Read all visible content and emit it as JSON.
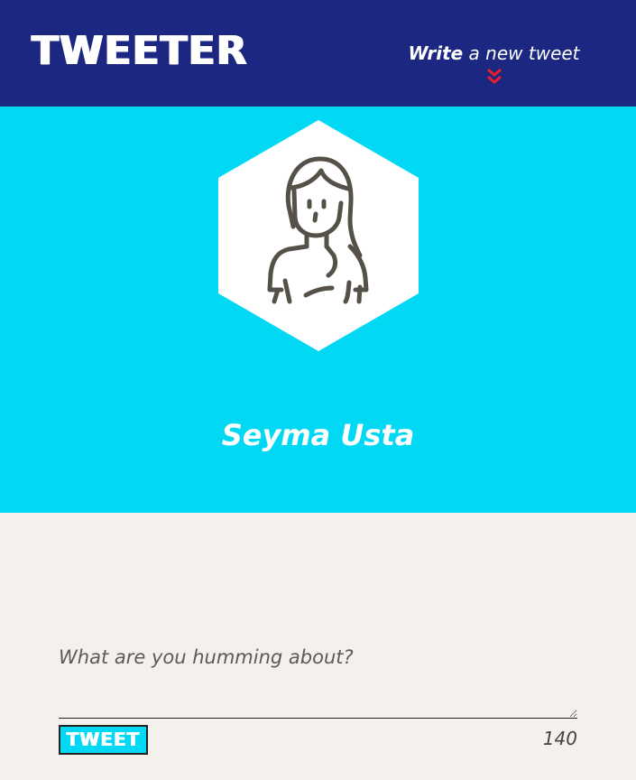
{
  "nav": {
    "logo": "TWEETER",
    "write_strong": "Write",
    "write_rest": " a new tweet",
    "toggle_icon": "double-chevron-down-icon"
  },
  "profile": {
    "name": "Seyma Usta",
    "avatar_icon": "woman-avatar-icon"
  },
  "compose": {
    "placeholder": "What are you humming about?",
    "value": "",
    "button_label": "TWEET",
    "char_count": "140"
  },
  "colors": {
    "nav_bg": "#1c2781",
    "profile_bg": "#00d8f4",
    "page_bg": "#f4f1ed",
    "accent_red": "#e5202a",
    "text_white": "#ffffff"
  }
}
